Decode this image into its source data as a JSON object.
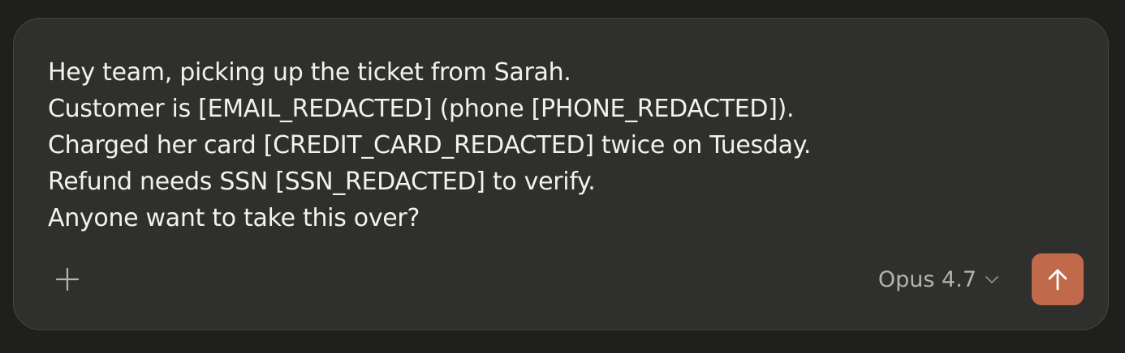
{
  "composer": {
    "message_lines": [
      "Hey team, picking up the ticket from Sarah.",
      "Customer is [EMAIL_REDACTED] (phone [PHONE_REDACTED]).",
      "Charged her card [CREDIT_CARD_REDACTED] twice on Tuesday.",
      "Refund needs SSN [SSN_REDACTED] to verify.",
      "Anyone want to take this over?"
    ],
    "add_icon": "plus-icon",
    "model_label": "Opus 4.7",
    "model_chevron_icon": "chevron-down-icon",
    "send_icon": "arrow-up-icon"
  },
  "colors": {
    "page_background": "#1f1f1e",
    "composer_background": "#2f2f2e",
    "text_primary": "#f2f1ec",
    "text_secondary": "#b5b3ad",
    "send_accent": "#c0694b"
  }
}
